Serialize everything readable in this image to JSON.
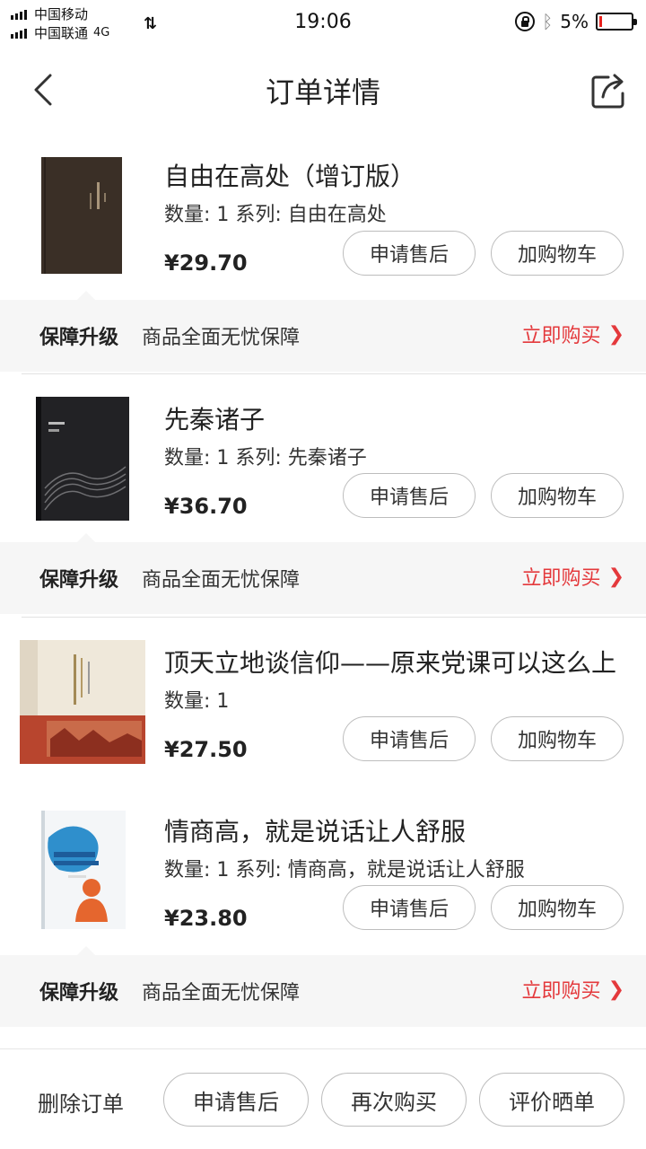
{
  "status_bar": {
    "carrier1": "中国移动",
    "carrier2": "中国联通",
    "network_type": "4G",
    "time": "19:06",
    "battery_percent": "5%",
    "battery_level": 0.05,
    "accent_color": "#e8211d"
  },
  "header": {
    "title": "订单详情",
    "back_icon": "chevron-left-icon",
    "share_icon": "share-icon"
  },
  "items": [
    {
      "title": "自由在高处（增订版）",
      "quantity_line": "数量: 1 系列: 自由在高处",
      "price": "¥29.70",
      "after_sale_label": "申请售后",
      "add_cart_label": "加购物车"
    },
    {
      "title": "先秦诸子",
      "quantity_line": "数量: 1 系列: 先秦诸子",
      "price": "¥36.70",
      "after_sale_label": "申请售后",
      "add_cart_label": "加购物车"
    },
    {
      "title": "顶天立地谈信仰——原来党课可以这么上",
      "quantity_line": "数量: 1",
      "price": "¥27.50",
      "after_sale_label": "申请售后",
      "add_cart_label": "加购物车"
    },
    {
      "title": "情商高，就是说话让人舒服",
      "quantity_line": "数量: 1 系列: 情商高，就是说话让人舒服",
      "price": "¥23.80",
      "after_sale_label": "申请售后",
      "add_cart_label": "加购物车"
    }
  ],
  "guarantee": {
    "label": "保障升级",
    "description": "商品全面无忧保障",
    "buy_label": "立即购买",
    "buy_color": "#e4393c"
  },
  "bottom_bar": {
    "delete_label": "删除订单",
    "after_sale_label": "申请售后",
    "rebuy_label": "再次购买",
    "review_label": "评价晒单"
  }
}
